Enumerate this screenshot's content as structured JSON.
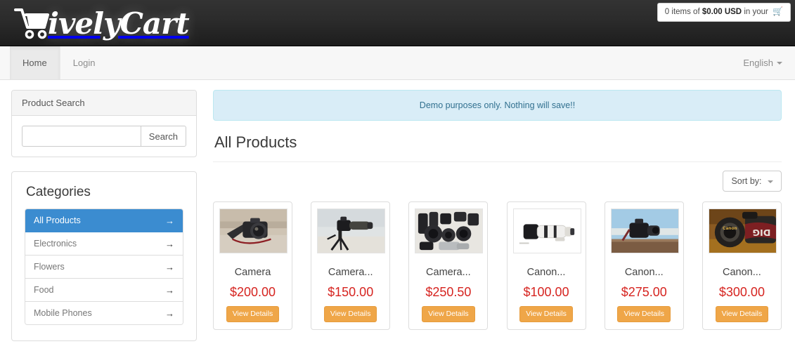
{
  "brand": {
    "name_cursive": "ively",
    "name_cursive2": "Cart",
    "cart_icon": "shopping-cart-icon"
  },
  "cart_widget": {
    "prefix": "0 items of ",
    "amount": "$0.00 USD",
    "suffix": " in your ",
    "cart_glyph": "🛒"
  },
  "nav": {
    "items": [
      {
        "label": "Home",
        "active": true
      },
      {
        "label": "Login",
        "active": false
      }
    ],
    "language": "English"
  },
  "sidebar": {
    "search_panel": {
      "heading": "Product Search",
      "input_value": "",
      "input_placeholder": "",
      "button_label": "Search"
    },
    "categories_panel": {
      "title": "Categories",
      "items": [
        {
          "label": "All Products",
          "active": true
        },
        {
          "label": "Electronics",
          "active": false
        },
        {
          "label": "Flowers",
          "active": false
        },
        {
          "label": "Food",
          "active": false
        },
        {
          "label": "Mobile Phones",
          "active": false
        }
      ],
      "arrow_glyph": "→"
    }
  },
  "main": {
    "alert": "Demo purposes only. Nothing will save!!",
    "page_title": "All Products",
    "sort_label": "Sort by:",
    "products": [
      {
        "name": "Camera",
        "price": "$200.00",
        "button": "View Details",
        "image": "dslr-camera-on-ground"
      },
      {
        "name": "Camera...",
        "price": "$150.00",
        "button": "View Details",
        "image": "camera-on-tripod-beach"
      },
      {
        "name": "Camera...",
        "price": "$250.50",
        "button": "View Details",
        "image": "camera-lenses-group"
      },
      {
        "name": "Canon...",
        "price": "$100.00",
        "button": "View Details",
        "image": "white-telephoto-lens"
      },
      {
        "name": "Canon...",
        "price": "$275.00",
        "button": "View Details",
        "image": "camera-on-wood-sky"
      },
      {
        "name": "Canon...",
        "price": "$300.00",
        "button": "View Details",
        "image": "canon-camera-closeup"
      }
    ]
  },
  "colors": {
    "accent_blue": "#3b8cd0",
    "price_red": "#d62420",
    "button_orange": "#efa648",
    "alert_bg": "#d9edf7",
    "header_dark": "#2b2b2b"
  }
}
